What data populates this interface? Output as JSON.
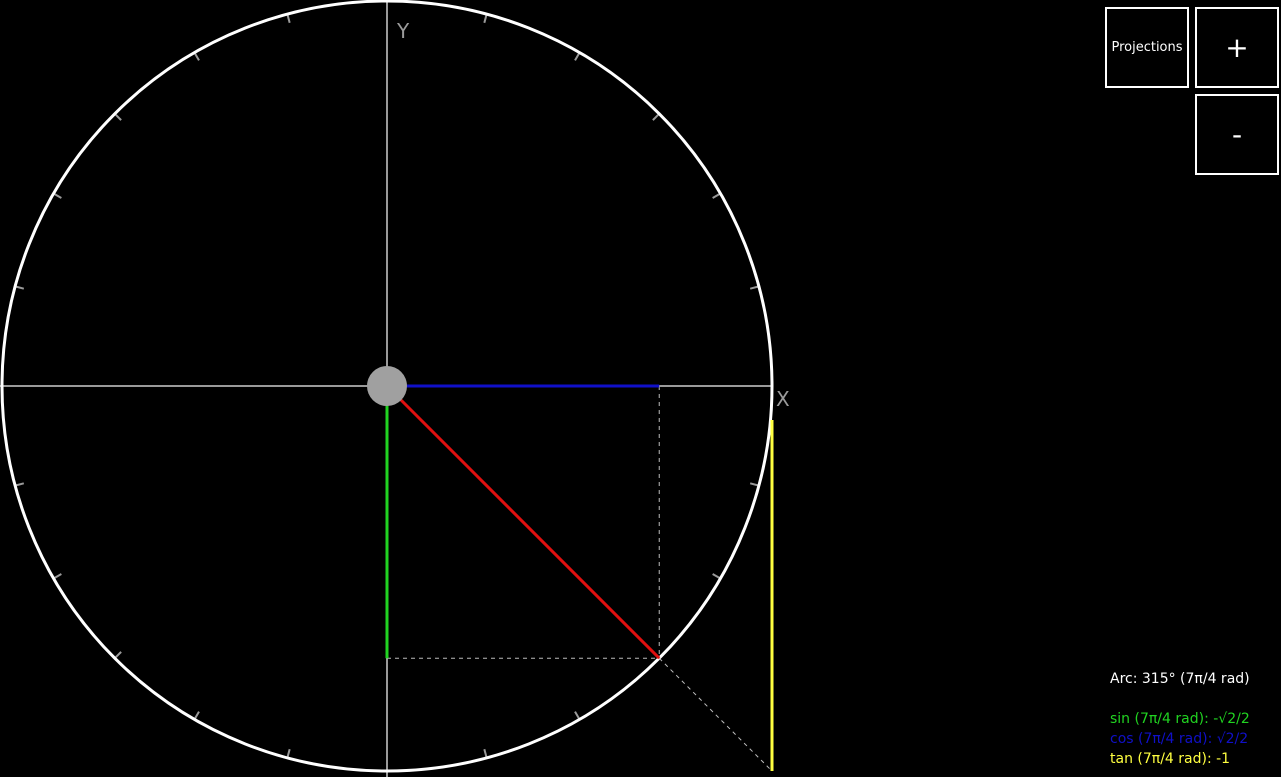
{
  "toolbar": {
    "projections_label": "Projections",
    "zoom_in_label": "+",
    "zoom_out_label": "-"
  },
  "axes": {
    "x_label": "X",
    "y_label": "Y"
  },
  "angle_degrees": 315,
  "readouts": {
    "arc": "Arc: 315° (7π/4 rad)",
    "sin": "sin (7π/4 rad): -√2/2",
    "cos": "cos (7π/4 rad): √2/2",
    "tan": "tan (7π/4 rad): -1"
  },
  "colors": {
    "background": "#000000",
    "circle": "#ffffff",
    "axes": "#9a9a9a",
    "radius": "#e01010",
    "sin": "#21d321",
    "cos": "#1010c8",
    "tan": "#ffff40",
    "projection_dashes": "#bbbbbb"
  }
}
